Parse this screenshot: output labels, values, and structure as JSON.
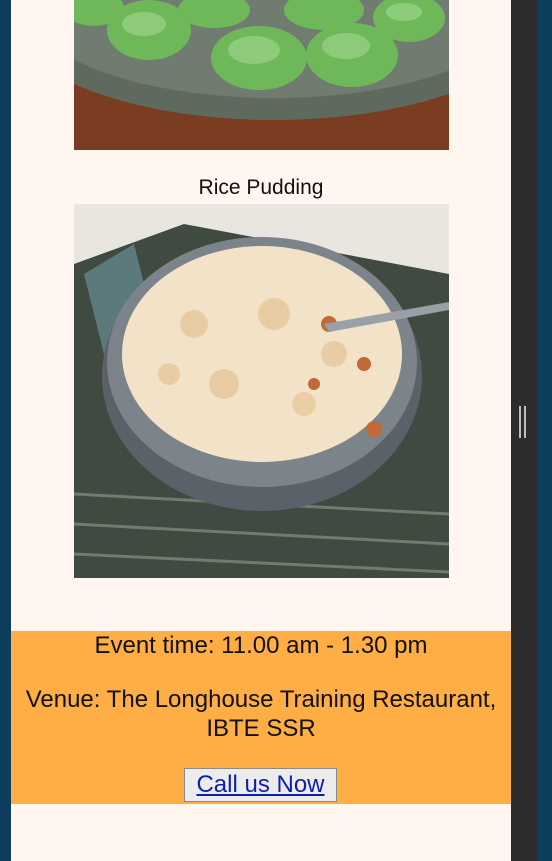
{
  "gallery": {
    "top_image_alt": "Green coconut rice cakes",
    "pudding_caption": "Rice Pudding",
    "pudding_image_alt": "Rice Pudding"
  },
  "event": {
    "time": "Event time: 11.00 am - 1.30 pm",
    "venue_line1": "Venue: The Longhouse Training Restaurant,",
    "venue_line2": "IBTE SSR",
    "call_button": "Call us Now"
  },
  "colors": {
    "page_bg": "#fff6f0",
    "event_band": "#ffad45",
    "link": "#0b1fb3",
    "scrollbar": "#2c2c2e",
    "outer": "#0d3d5c"
  }
}
